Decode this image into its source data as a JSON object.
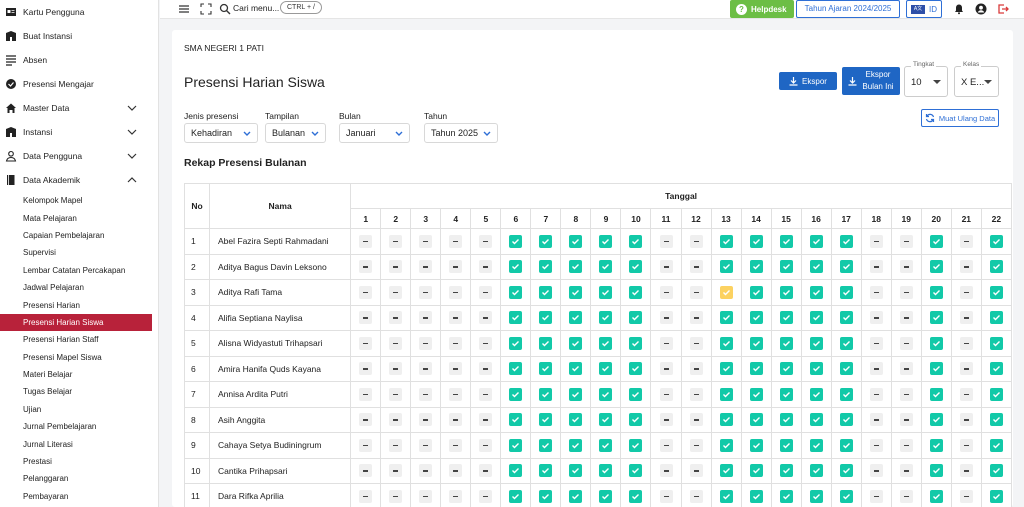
{
  "sidebar": {
    "items": [
      {
        "label": "Kartu Pengguna",
        "icon": "id-card-icon"
      },
      {
        "label": "Buat Instansi",
        "icon": "building-icon"
      },
      {
        "label": "Absen",
        "icon": "list-icon"
      },
      {
        "label": "Presensi Mengajar",
        "icon": "check-circle-icon"
      },
      {
        "label": "Master Data",
        "icon": "home-icon"
      },
      {
        "label": "Instansi",
        "icon": "building-icon"
      },
      {
        "label": "Data Pengguna",
        "icon": "user-icon"
      },
      {
        "label": "Data Akademik",
        "icon": "book-icon"
      }
    ],
    "sub_items": [
      "Kelompok Mapel",
      "Mata Pelajaran",
      "Capaian Pembelajaran",
      "Supervisi",
      "Lembar Catatan Percakapan",
      "Jadwal Pelajaran",
      "Presensi Harian",
      "Presensi Harian Siswa",
      "Presensi Harian Staff",
      "Presensi Mapel Siswa",
      "Materi Belajar",
      "Tugas Belajar",
      "Ujian",
      "Jurnal Pembelajaran",
      "Jurnal Literasi",
      "Prestasi",
      "Pelanggaran",
      "Pembayaran"
    ],
    "active_sub": "Presensi Harian Siswa"
  },
  "topbar": {
    "search_placeholder": "Cari menu...",
    "shortcut": "CTRL + /",
    "helpdesk": "Helpdesk",
    "school_year": "Tahun Ajaran 2024/2025",
    "lang": "ID"
  },
  "main": {
    "school": "SMA NEGERI 1 PATI",
    "title": "Presensi Harian Siswa",
    "export": "Ekspor",
    "export_month_l1": "Ekspor",
    "export_month_l2": "Bulan Ini",
    "tingkat": {
      "label": "Tingkat",
      "value": "10"
    },
    "kelas": {
      "label": "Kelas",
      "value": "X E..."
    },
    "filters": {
      "jenis": {
        "label": "Jenis presensi",
        "value": "Kehadiran"
      },
      "tampilan": {
        "label": "Tampilan",
        "value": "Bulanan"
      },
      "bulan": {
        "label": "Bulan",
        "value": "Januari"
      },
      "tahun": {
        "label": "Tahun",
        "value": "Tahun 2025"
      }
    },
    "reload": "Muat Ulang Data",
    "section": "Rekap Presensi Bulanan"
  },
  "table": {
    "col_no": "No",
    "col_name": "Nama",
    "col_date": "Tanggal",
    "days": [
      "1",
      "2",
      "3",
      "4",
      "5",
      "6",
      "7",
      "8",
      "9",
      "10",
      "11",
      "12",
      "13",
      "14",
      "15",
      "16",
      "17",
      "18",
      "19",
      "20",
      "21",
      "22"
    ],
    "rows": [
      {
        "no": "1",
        "name": "Abel Fazira Septi Rahmadani",
        "marks": "-----PPPPP--PPPPP--P-P"
      },
      {
        "no": "2",
        "name": "Aditya Bagus Davin Leksono",
        "marks": "-----PPPPP--PPPPP--P-P"
      },
      {
        "no": "3",
        "name": "Aditya Rafi Tama",
        "marks": "-----PPPPP--LPPPP--P-P"
      },
      {
        "no": "4",
        "name": "Alifia Septiana Naylisa",
        "marks": "-----PPPPP--PPPPP--P-P"
      },
      {
        "no": "5",
        "name": "Alisna Widyastuti Trihapsari",
        "marks": "-----PPPPP--PPPPP--P-P"
      },
      {
        "no": "6",
        "name": "Amira Hanifa Quds Kayana",
        "marks": "-----PPPPP--PPPPP--P-P"
      },
      {
        "no": "7",
        "name": "Annisa Ardita Putri",
        "marks": "-----PPPPP--PPPPP--P-P"
      },
      {
        "no": "8",
        "name": "Asih Anggita",
        "marks": "-----PPPPP--PPPPP--P-P"
      },
      {
        "no": "9",
        "name": "Cahaya Setya Budiningrum",
        "marks": "-----PPPPP--PPPPP--P-P"
      },
      {
        "no": "10",
        "name": "Cantika Prihapsari",
        "marks": "-----PPPPP--PPPPP--P-P"
      },
      {
        "no": "11",
        "name": "Dara Rifka Aprilia",
        "marks": "-----PPPPP--PPPPP--P-P"
      }
    ]
  },
  "colors": {
    "accent": "#1f66c4",
    "active": "#b8223a",
    "present": "#12c9a8",
    "late": "#fcd261",
    "help": "#6cbe45"
  }
}
